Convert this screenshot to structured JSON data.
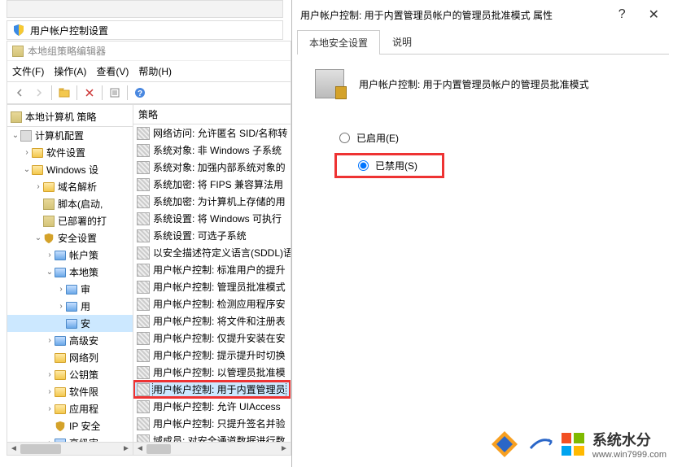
{
  "uac_bar": {
    "title": "用户帐户控制设置"
  },
  "gpe": {
    "title": "本地组策略编辑器",
    "menu": {
      "file": "文件(F)",
      "action": "操作(A)",
      "view": "查看(V)",
      "help": "帮助(H)"
    },
    "tree_header": "本地计算机 策略",
    "list_header": "策略",
    "tree": [
      {
        "label": "计算机配置",
        "depth": 0,
        "caret": "v",
        "icon": "comp"
      },
      {
        "label": "软件设置",
        "depth": 1,
        "caret": ">",
        "icon": "folder"
      },
      {
        "label": "Windows 设",
        "depth": 1,
        "caret": "v",
        "icon": "folder"
      },
      {
        "label": "域名解析",
        "depth": 2,
        "caret": ">",
        "icon": "folder"
      },
      {
        "label": "脚本(启动,",
        "depth": 2,
        "caret": "",
        "icon": "policy"
      },
      {
        "label": "已部署的打",
        "depth": 2,
        "caret": "",
        "icon": "policy"
      },
      {
        "label": "安全设置",
        "depth": 2,
        "caret": "v",
        "icon": "shield"
      },
      {
        "label": "帐户策",
        "depth": 3,
        "caret": ">",
        "icon": "folderb"
      },
      {
        "label": "本地策",
        "depth": 3,
        "caret": "v",
        "icon": "folderb"
      },
      {
        "label": "审",
        "depth": 4,
        "caret": ">",
        "icon": "folderb"
      },
      {
        "label": "用",
        "depth": 4,
        "caret": ">",
        "icon": "folderb"
      },
      {
        "label": "安",
        "depth": 4,
        "caret": "",
        "icon": "folderb",
        "selected": true
      },
      {
        "label": "高级安",
        "depth": 3,
        "caret": ">",
        "icon": "folderb"
      },
      {
        "label": "网络列",
        "depth": 3,
        "caret": "",
        "icon": "folder"
      },
      {
        "label": "公钥策",
        "depth": 3,
        "caret": ">",
        "icon": "folder"
      },
      {
        "label": "软件限",
        "depth": 3,
        "caret": ">",
        "icon": "folder"
      },
      {
        "label": "应用程",
        "depth": 3,
        "caret": ">",
        "icon": "folder"
      },
      {
        "label": "IP 安全",
        "depth": 3,
        "caret": "",
        "icon": "shield"
      },
      {
        "label": "高级审",
        "depth": 3,
        "caret": ">",
        "icon": "folderb"
      }
    ],
    "policies": [
      "网络访问: 允许匿名 SID/名称转",
      "系统对象: 非 Windows 子系统",
      "系统对象: 加强内部系统对象的",
      "系统加密: 将 FIPS 兼容算法用",
      "系统加密: 为计算机上存储的用",
      "系统设置: 将 Windows 可执行",
      "系统设置: 可选子系统",
      "以安全描述符定义语言(SDDL)语",
      "用户帐户控制: 标准用户的提升",
      "用户帐户控制: 管理员批准模式",
      "用户帐户控制: 检测应用程序安",
      "用户帐户控制: 将文件和注册表",
      "用户帐户控制: 仅提升安装在安",
      "用户帐户控制: 提示提升时切换",
      "用户帐户控制: 以管理员批准模",
      "用户帐户控制: 用于内置管理员",
      "用户帐户控制: 允许 UIAccess",
      "用户帐户控制: 只提升签名并验",
      "域成员: 对安全通道数据进行数"
    ],
    "highlight_index": 15
  },
  "dialog": {
    "title": "用户帐户控制: 用于内置管理员帐户的管理员批准模式 属性",
    "tab1": "本地安全设置",
    "tab2": "说明",
    "description": "用户帐户控制: 用于内置管理员帐户的管理员批准模式",
    "opt_enabled": "已启用(E)",
    "opt_disabled": "已禁用(S)"
  },
  "watermark": {
    "text": "系统水分",
    "url": "www.win7999.com"
  }
}
